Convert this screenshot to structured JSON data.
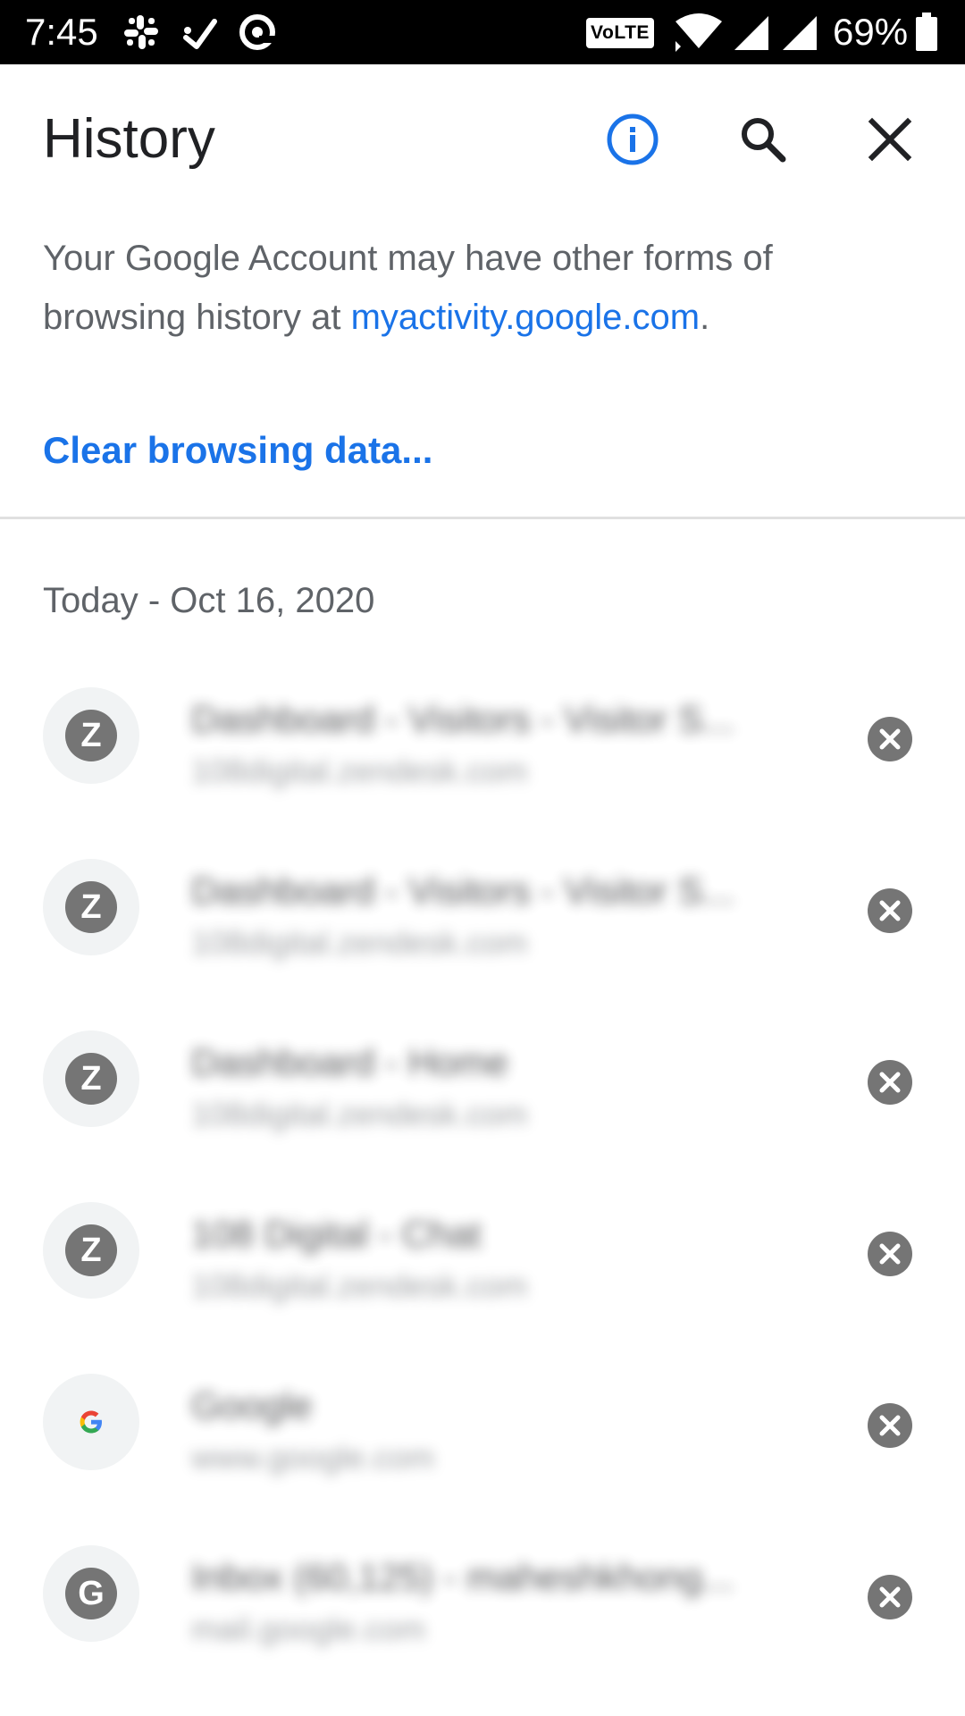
{
  "status_bar": {
    "time": "7:45",
    "volte_label": "VoLTE",
    "battery_percent": "69%",
    "icons": [
      "slack-icon",
      "missed-call-icon",
      "at-sign-icon",
      "wifi-icon",
      "signal-icon",
      "signal-icon",
      "battery-icon"
    ]
  },
  "header": {
    "title": "History",
    "info_icon": "info-icon",
    "search_icon": "search-icon",
    "close_icon": "close-icon",
    "accent_color": "#1a73e8"
  },
  "notice": {
    "text_before": "Your Google Account may have other forms of browsing history at ",
    "link_text": "myactivity.google.com",
    "text_after": "."
  },
  "clear_browsing_data_label": "Clear browsing data...",
  "date_header": "Today - Oct 16, 2020",
  "history_items": [
    {
      "favicon_letter": "Z",
      "title": "Dashboard - Visitors - Visitor S...",
      "url": "108digital.zendesk.com"
    },
    {
      "favicon_letter": "Z",
      "title": "Dashboard - Visitors - Visitor S...",
      "url": "108digital.zendesk.com"
    },
    {
      "favicon_letter": "Z",
      "title": "Dashboard - Home",
      "url": "108digital.zendesk.com"
    },
    {
      "favicon_letter": "Z",
      "title": "108 Digital - Chat",
      "url": "108digital.zendesk.com"
    },
    {
      "favicon_letter": "",
      "favicon_icon": "google-logo-icon",
      "title": "Google",
      "url": "www.google.com"
    },
    {
      "favicon_letter": "G",
      "title": "Inbox (60,125) - maheshkhong...",
      "url": "mail.google.com"
    }
  ]
}
